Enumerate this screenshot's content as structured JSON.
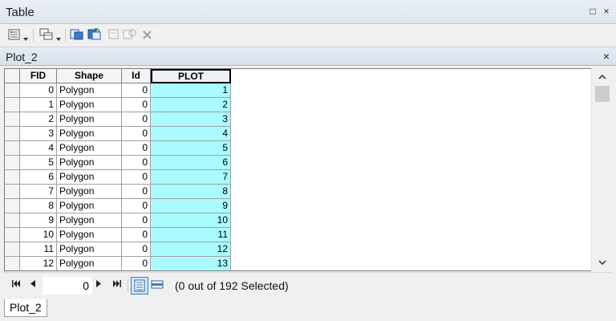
{
  "window": {
    "title": "Table",
    "restore_glyph": "□",
    "close_glyph": "×"
  },
  "toolbar": {
    "icons": [
      "table-options-icon",
      "dropdown-arrow-icon",
      "related-tables-icon",
      "dropdown-arrow-icon",
      "select-by-attributes-icon",
      "switch-selection-icon",
      "clear-selection-icon",
      "zoom-to-selected-icon",
      "delete-selected-icon"
    ]
  },
  "tab": {
    "name": "Plot_2",
    "close_glyph": "×"
  },
  "table": {
    "columns": [
      "FID",
      "Shape",
      "Id",
      "PLOT"
    ],
    "rows": [
      [
        "0",
        "Polygon",
        "0",
        "1"
      ],
      [
        "1",
        "Polygon",
        "0",
        "2"
      ],
      [
        "2",
        "Polygon",
        "0",
        "3"
      ],
      [
        "3",
        "Polygon",
        "0",
        "4"
      ],
      [
        "4",
        "Polygon",
        "0",
        "5"
      ],
      [
        "5",
        "Polygon",
        "0",
        "6"
      ],
      [
        "6",
        "Polygon",
        "0",
        "7"
      ],
      [
        "7",
        "Polygon",
        "0",
        "8"
      ],
      [
        "8",
        "Polygon",
        "0",
        "9"
      ],
      [
        "9",
        "Polygon",
        "0",
        "10"
      ],
      [
        "10",
        "Polygon",
        "0",
        "11"
      ],
      [
        "11",
        "Polygon",
        "0",
        "12"
      ],
      [
        "12",
        "Polygon",
        "0",
        "13"
      ]
    ],
    "selected_column": "PLOT",
    "selected_column_color": "#a9fbff"
  },
  "scrollbar": {
    "up_glyph": "⌃",
    "down_glyph": "⌄"
  },
  "navigation": {
    "first_glyph": "|◀",
    "prev_glyph": "◀",
    "record_value": "0",
    "next_glyph": "▶",
    "last_glyph": "▶|",
    "status": "(0 out of 192 Selected)"
  },
  "bottom_tab": {
    "name": "Plot_2"
  }
}
